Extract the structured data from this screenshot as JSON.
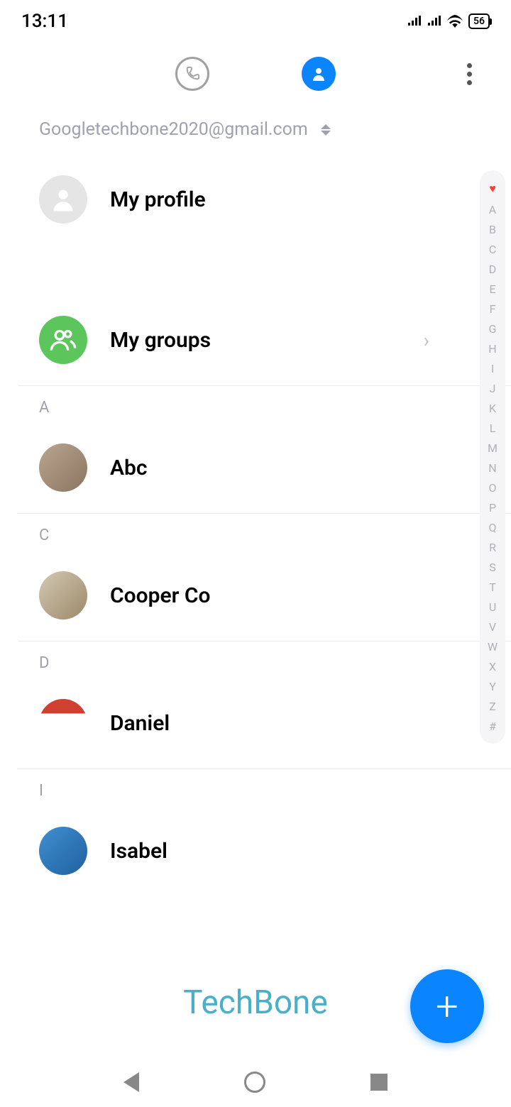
{
  "status": {
    "time": "13:11",
    "battery": "56"
  },
  "account": {
    "email": "Googletechbone2020@gmail.com"
  },
  "profile": {
    "label": "My profile"
  },
  "groups": {
    "label": "My groups"
  },
  "sections": [
    {
      "letter": "A",
      "contacts": [
        {
          "name": "Abc"
        }
      ]
    },
    {
      "letter": "C",
      "contacts": [
        {
          "name": "Cooper Co"
        }
      ]
    },
    {
      "letter": "D",
      "contacts": [
        {
          "name": "Daniel"
        }
      ]
    },
    {
      "letter": "I",
      "contacts": [
        {
          "name": "Isabel"
        }
      ]
    }
  ],
  "alphaIndex": [
    "A",
    "B",
    "C",
    "D",
    "E",
    "F",
    "G",
    "H",
    "I",
    "J",
    "K",
    "L",
    "M",
    "N",
    "O",
    "P",
    "Q",
    "R",
    "S",
    "T",
    "U",
    "V",
    "W",
    "X",
    "Y",
    "Z",
    "#"
  ],
  "watermark": "TechBone"
}
